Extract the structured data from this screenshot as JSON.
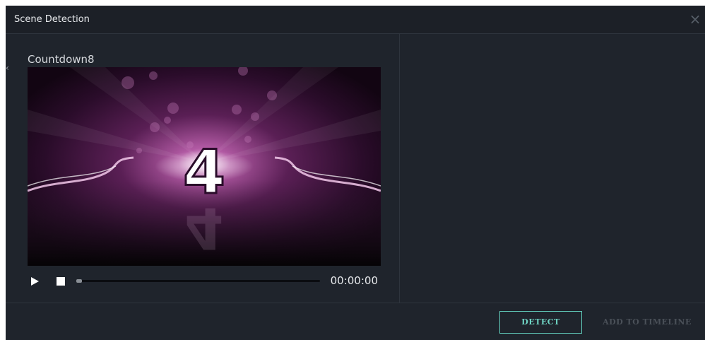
{
  "dialog": {
    "title": "Scene Detection",
    "close_icon": "close-icon"
  },
  "preview": {
    "clip_name": "Countdown8",
    "frame_number": "4",
    "time": "00:00:00",
    "progress": 0.0
  },
  "controls": {
    "play_icon": "play-icon",
    "stop_icon": "stop-icon"
  },
  "footer": {
    "detect_label": "DETECT",
    "add_label": "ADD TO TIMELINE"
  },
  "colors": {
    "dialog_bg": "#1f242c",
    "accent": "#5fc7b7",
    "disabled_text": "#4a5058"
  }
}
